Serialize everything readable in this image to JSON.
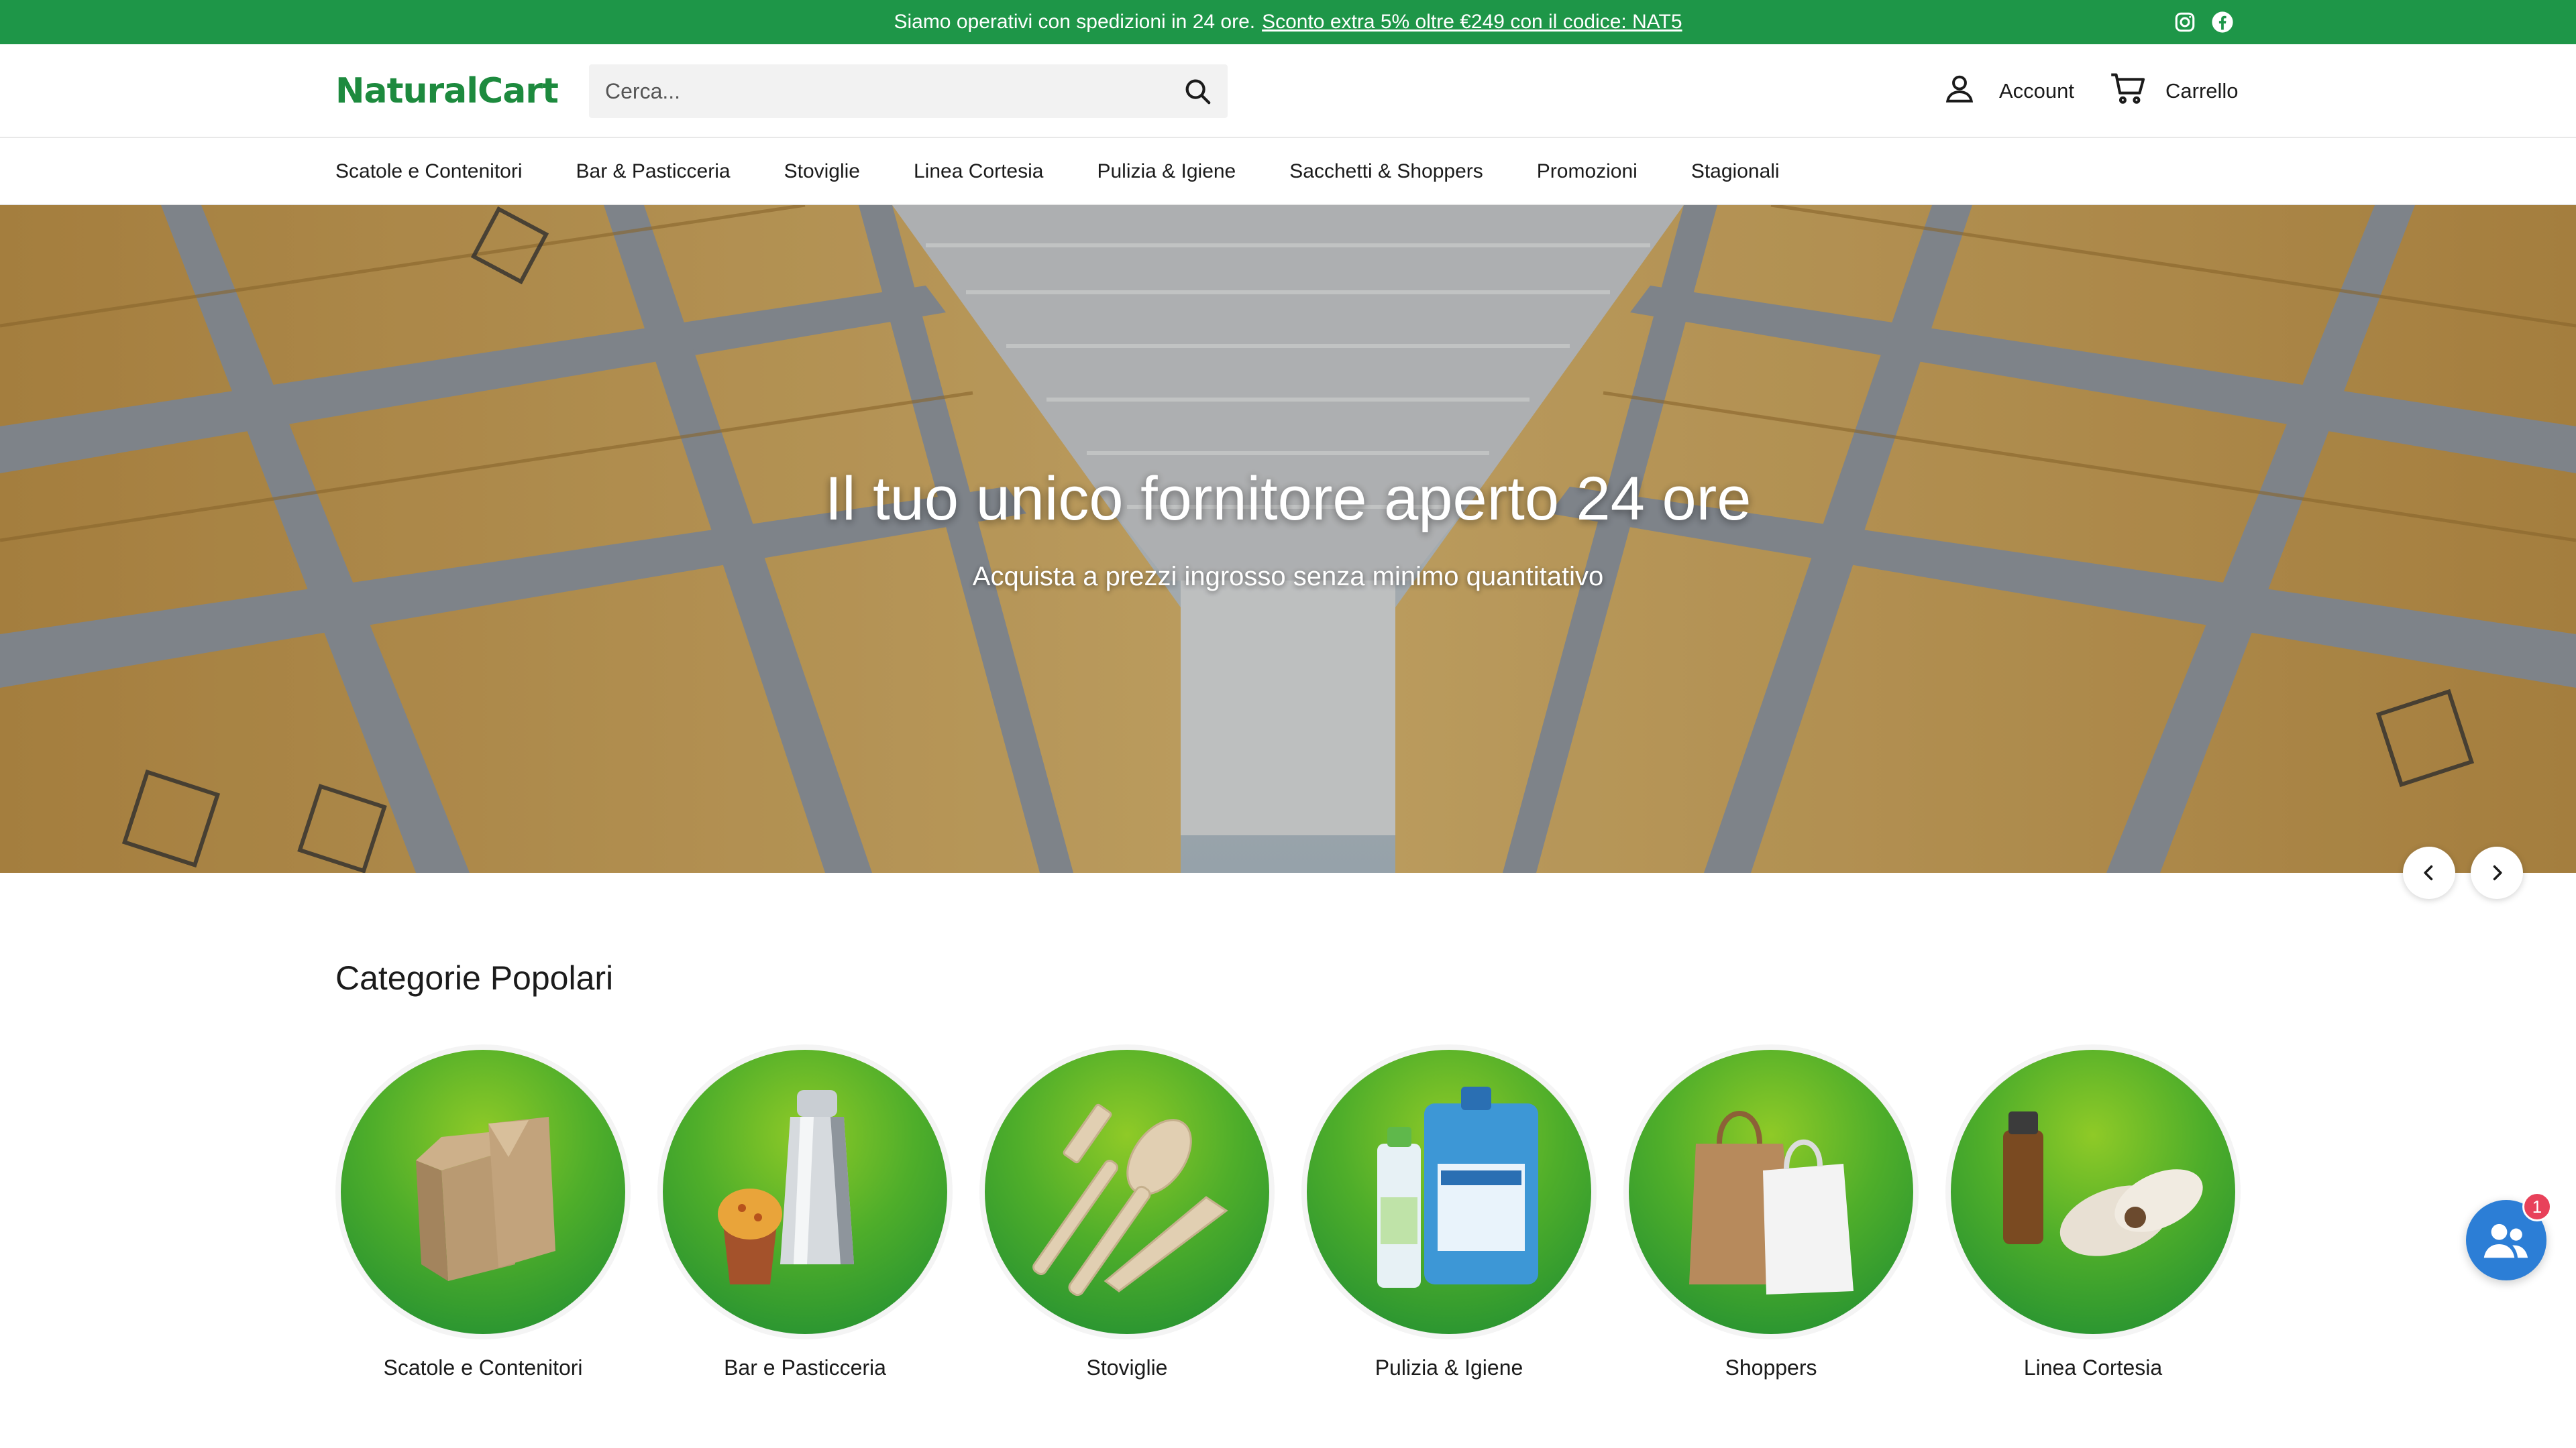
{
  "announcement": {
    "text": "Siamo operativi con spedizioni in 24 ore.",
    "promo_link": "Sconto extra 5% oltre €249 con il codice: NAT5",
    "socials": [
      "instagram-icon",
      "facebook-icon"
    ]
  },
  "header": {
    "logo": "NaturalCart",
    "search_placeholder": "Cerca...",
    "account_label": "Account",
    "cart_label": "Carrello"
  },
  "nav": {
    "items": [
      "Scatole e Contenitori",
      "Bar & Pasticceria",
      "Stoviglie",
      "Linea Cortesia",
      "Pulizia & Igiene",
      "Sacchetti & Shoppers",
      "Promozioni",
      "Stagionali"
    ]
  },
  "hero": {
    "title": "Il tuo unico fornitore aperto 24 ore",
    "subtitle": "Acquista a prezzi ingrosso senza minimo quantitativo"
  },
  "categories": {
    "title": "Categorie Popolari",
    "items": [
      "Scatole e Contenitori",
      "Bar e Pasticceria",
      "Stoviglie",
      "Pulizia & Igiene",
      "Shoppers",
      "Linea Cortesia"
    ]
  },
  "chat": {
    "badge_count": "1"
  },
  "colors": {
    "brand_green": "#1e9648",
    "logo_green": "#1d8a3e",
    "chat_blue": "#2c7ed6",
    "badge_red": "#e8415a"
  }
}
